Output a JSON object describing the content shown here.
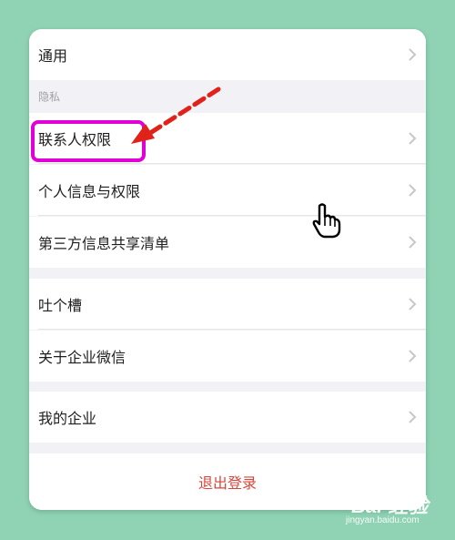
{
  "settings": {
    "general_label": "通用",
    "privacy_section_label": "隐私",
    "contact_permission_label": "联系人权限",
    "personal_info_label": "个人信息与权限",
    "third_party_share_label": "第三方信息共享清单",
    "feedback_label": "吐个槽",
    "about_label": "关于企业微信",
    "my_enterprise_label": "我的企业",
    "logout_label": "退出登录"
  },
  "icons": {
    "chevron": "chevron-right-icon",
    "cursor": "hand-cursor-icon",
    "arrow": "annotation-arrow-icon"
  },
  "colors": {
    "background": "#8fd3b4",
    "logout_text": "#d8463b",
    "highlight": "#e100d6",
    "annotation_arrow": "#e0221a"
  },
  "watermark": {
    "brand": "Bai 经验",
    "url": "jingyan.baidu.com"
  }
}
